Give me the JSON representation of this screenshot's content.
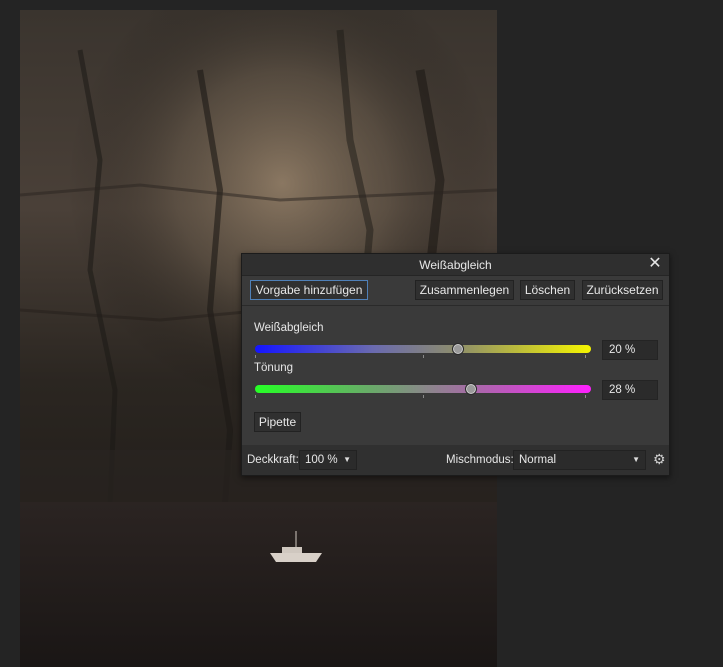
{
  "panel": {
    "title": "Weißabgleich",
    "buttons": {
      "add_preset": "Vorgabe hinzufügen",
      "merge": "Zusammenlegen",
      "delete": "Löschen",
      "reset": "Zurücksetzen"
    },
    "white_balance": {
      "label": "Weißabgleich",
      "value_text": "20 %",
      "value_fraction": 0.6
    },
    "tint": {
      "label": "Tönung",
      "value_text": "28 %",
      "value_fraction": 0.64
    },
    "picker_label": "Pipette",
    "footer": {
      "opacity_label": "Deckkraft:",
      "opacity_value": "100 %",
      "blend_label": "Mischmodus:",
      "blend_value": "Normal"
    }
  },
  "icons": {
    "close": "close-icon",
    "gear": "gear-icon",
    "dropdown": "chevron-down-icon"
  },
  "colors": {
    "app_background": "#242424",
    "panel_background": "#3a3a3a",
    "focus_border": "#4f80b8",
    "wb_gradient_start": "#1414ff",
    "wb_gradient_end": "#f5f500",
    "tint_gradient_start": "#26ff26",
    "tint_gradient_end": "#ff20ff"
  }
}
